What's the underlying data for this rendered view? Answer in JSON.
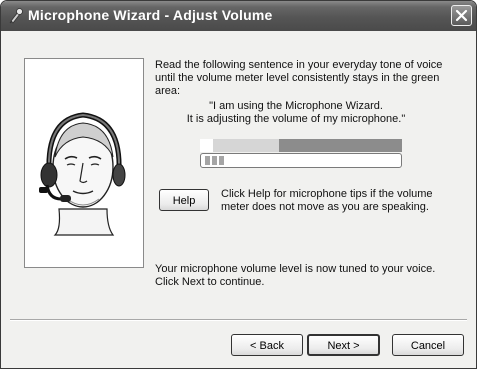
{
  "window": {
    "title": "Microphone Wizard - Adjust Volume",
    "icon": "microphone-wizard-icon",
    "close_icon": "close-x-icon"
  },
  "content": {
    "image": "headset-head-illustration",
    "instructions": "Read the following sentence in your everyday tone of voice\nuntil the volume meter level consistently stays in the green\narea:",
    "quote": "\"I am using the Microphone Wizard.\nIt is adjusting the volume of my microphone.\"",
    "meter": {
      "level_fraction": 0.1
    },
    "help_button_label": "Help",
    "help_text": "Click Help for microphone tips if the volume\nmeter does not move as you are speaking.",
    "tuned_text": "Your microphone volume level is now tuned to your voice.\nClick Next to continue."
  },
  "footer": {
    "back_label": "< Back",
    "next_label": "Next >",
    "cancel_label": "Cancel"
  }
}
